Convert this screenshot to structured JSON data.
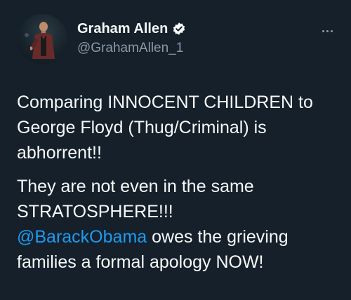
{
  "tweet": {
    "author": {
      "display_name": "Graham Allen",
      "handle": "@GrahamAllen_1",
      "verified": true,
      "avatar_icon": "profile-photo-person-on-stage"
    },
    "more_icon": "ellipsis-icon",
    "paragraph1": "Comparing INNOCENT CHILDREN to George Floyd (Thug/Criminal) is abhorrent!!",
    "paragraph2_line": "They are not even in the same STRATOSPHERE!!!",
    "mention": "@BarackObama",
    "paragraph2_rest": " owes the grieving families a formal apology NOW!"
  },
  "colors": {
    "background": "#15202b",
    "text": "#f7f9f9",
    "secondary_text": "#8b98a5",
    "link": "#1d9bf0",
    "verified_badge": "#ffffff"
  }
}
